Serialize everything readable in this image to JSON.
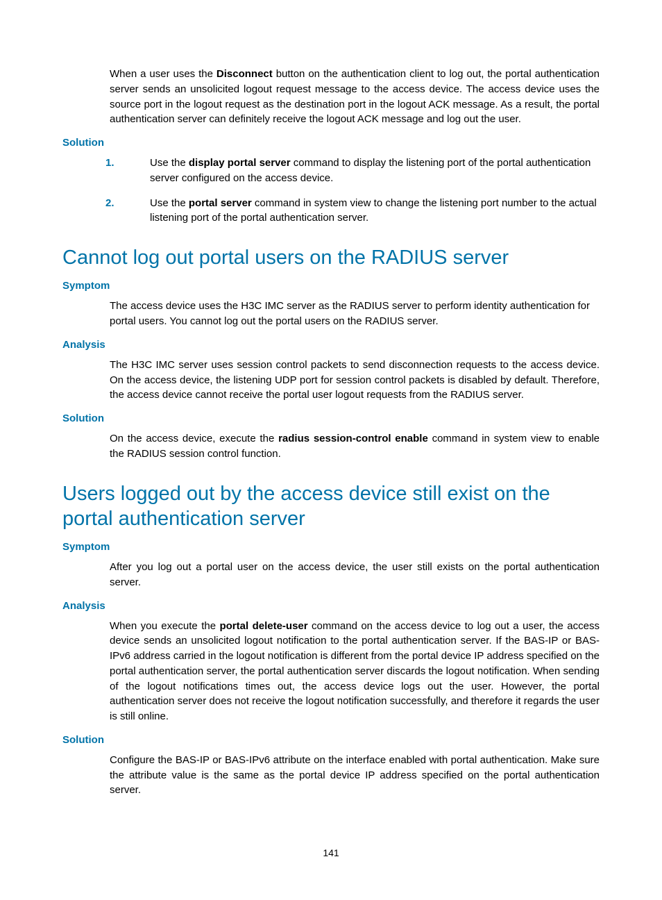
{
  "intro": {
    "p1a": "When a user uses the ",
    "p1b": "Disconnect",
    "p1c": " button on the authentication client to log out, the portal authentication server sends an unsolicited logout request message to the access device. The access device uses the source port in the logout request as the destination port in the logout ACK message. As a result, the portal authentication server can definitely receive the logout ACK message and log out the user."
  },
  "solution1": {
    "head": "Solution",
    "step1a": "Use the ",
    "step1b": "display portal server",
    "step1c": " command to display the listening port of the portal authentication server configured on the access device.",
    "step2a": "Use the ",
    "step2b": "portal server",
    "step2c": " command in system view to change the listening port number to the actual listening port of the portal authentication server.",
    "num1": "1.",
    "num2": "2."
  },
  "sec2": {
    "title": "Cannot log out portal users on the RADIUS server",
    "symptom_head": "Symptom",
    "symptom_p": "The access device uses the H3C IMC server as the RADIUS server to perform identity authentication for portal users. You cannot log out the portal users on the RADIUS server.",
    "analysis_head": "Analysis",
    "analysis_p": "The H3C IMC server uses session control packets to send disconnection requests to the access device. On the access device, the listening UDP port for session control packets is disabled by default. Therefore, the access device cannot receive the portal user logout requests from the RADIUS server.",
    "solution_head": "Solution",
    "solution_a": "On the access device, execute the ",
    "solution_b": "radius session-control enable",
    "solution_c": " command in system view to enable the RADIUS session control function."
  },
  "sec3": {
    "title": "Users logged out by the access device still exist on the portal authentication server",
    "symptom_head": "Symptom",
    "symptom_p": "After you log out a portal user on the access device, the user still exists on the portal authentication server.",
    "analysis_head": "Analysis",
    "analysis_a": "When you execute the ",
    "analysis_b": "portal delete-user",
    "analysis_c": " command on the access device to log out a user, the access device sends an unsolicited logout notification to the portal authentication server. If the BAS-IP or BAS-IPv6 address carried in the logout notification is different from the portal device IP address specified on the portal authentication server, the portal authentication server discards the logout notification. When sending of the logout notifications times out, the access device logs out the user. However, the portal authentication server does not receive the logout notification successfully, and therefore it regards the user is still online.",
    "solution_head": "Solution",
    "solution_p": "Configure the BAS-IP or BAS-IPv6 attribute on the interface enabled with portal authentication. Make sure the attribute value is the same as the portal device IP address specified on the portal authentication server."
  },
  "page_number": "141"
}
